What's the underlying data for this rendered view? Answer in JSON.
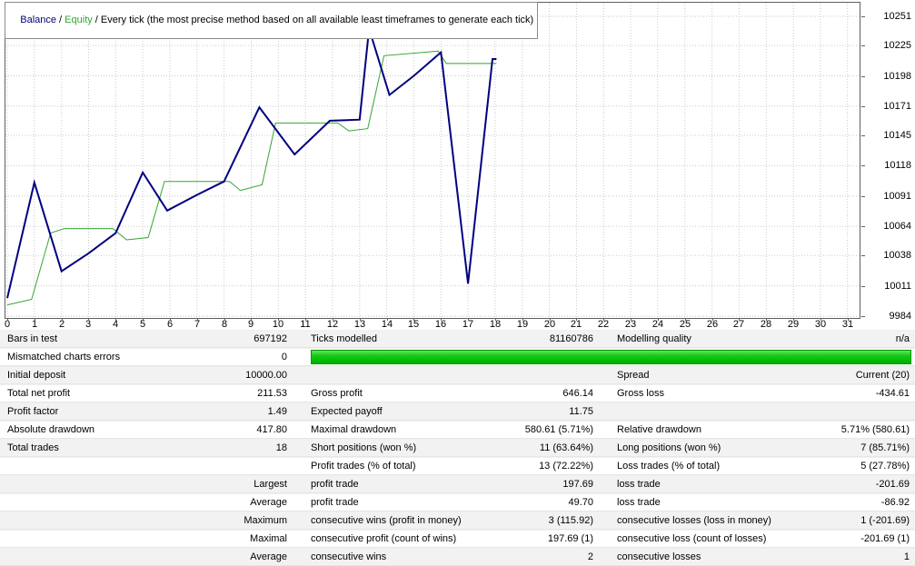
{
  "legend": {
    "balance_label": "Balance",
    "separator": " / ",
    "equity_label": "Equity",
    "method_label": " / Every tick (the most precise method based on all available least timeframes to generate each tick)"
  },
  "colors": {
    "balance_line": "#000080",
    "equity_line": "#32a532",
    "grid": "#c9c9c9",
    "quality_bar_green": "#12cb12",
    "row_alt_background": "#f2f2f2"
  },
  "chart_data": {
    "type": "line",
    "title": "",
    "xlabel": "",
    "ylabel": "",
    "grid": "dotted",
    "legend_position": "top-left",
    "xlim": [
      0,
      31.5
    ],
    "ylim": [
      9984,
      10251
    ],
    "x_ticks": [
      0,
      1,
      2,
      3,
      4,
      5,
      6,
      7,
      8,
      9,
      10,
      11,
      12,
      13,
      14,
      15,
      16,
      17,
      18,
      19,
      20,
      21,
      22,
      23,
      24,
      25,
      26,
      27,
      28,
      29,
      30,
      31
    ],
    "y_ticks": [
      10251,
      10225,
      10198,
      10171,
      10145,
      10118,
      10091,
      10064,
      10038,
      10011,
      9984
    ],
    "series": [
      {
        "name": "Balance",
        "color": "#000080",
        "width": 2,
        "points": [
          [
            0,
            10000
          ],
          [
            1,
            10103
          ],
          [
            2,
            10024
          ],
          [
            3,
            10040
          ],
          [
            4,
            10058
          ],
          [
            5,
            10112
          ],
          [
            5.9,
            10078
          ],
          [
            7,
            10092
          ],
          [
            8,
            10104
          ],
          [
            9.3,
            10170
          ],
          [
            10.6,
            10128
          ],
          [
            11.9,
            10158
          ],
          [
            13,
            10159
          ],
          [
            13.35,
            10240
          ],
          [
            14.1,
            10181
          ],
          [
            15,
            10198
          ],
          [
            16,
            10219
          ],
          [
            17,
            10013
          ],
          [
            17.9,
            10213
          ],
          [
            18.05,
            10213
          ]
        ]
      },
      {
        "name": "Equity",
        "color": "#32a532",
        "width": 1,
        "points": [
          [
            0,
            9994
          ],
          [
            0.9,
            9999
          ],
          [
            1.6,
            10058
          ],
          [
            2.1,
            10062
          ],
          [
            3.9,
            10062
          ],
          [
            4.4,
            10052
          ],
          [
            5.2,
            10054
          ],
          [
            5.8,
            10104
          ],
          [
            8.2,
            10104
          ],
          [
            8.6,
            10096
          ],
          [
            9.4,
            10101
          ],
          [
            9.9,
            10156
          ],
          [
            12.2,
            10156
          ],
          [
            12.6,
            10149
          ],
          [
            13.3,
            10151
          ],
          [
            13.9,
            10216
          ],
          [
            15.9,
            10220
          ],
          [
            16.2,
            10209
          ],
          [
            18.05,
            10209
          ]
        ]
      }
    ]
  },
  "report": {
    "rows": [
      {
        "cells": [
          "Bars in test",
          "697192",
          "Ticks modelled",
          "81160786",
          "Modelling quality",
          "n/a"
        ]
      },
      {
        "cells": [
          "Mismatched charts errors",
          "0",
          "",
          "",
          "",
          ""
        ],
        "quality_bar": true
      },
      {
        "cells": [
          "Initial deposit",
          "10000.00",
          "",
          "",
          "Spread",
          "Current (20)"
        ]
      },
      {
        "cells": [
          "Total net profit",
          "211.53",
          "Gross profit",
          "646.14",
          "Gross loss",
          "-434.61"
        ]
      },
      {
        "cells": [
          "Profit factor",
          "1.49",
          "Expected payoff",
          "11.75",
          "",
          ""
        ]
      },
      {
        "cells": [
          "Absolute drawdown",
          "417.80",
          "Maximal drawdown",
          "580.61 (5.71%)",
          "Relative drawdown",
          "5.71% (580.61)"
        ]
      },
      {
        "cells": [
          "Total trades",
          "18",
          "Short positions (won %)",
          "11 (63.64%)",
          "Long positions (won %)",
          "7 (85.71%)"
        ]
      },
      {
        "cells": [
          "",
          "",
          "Profit trades (% of total)",
          "13 (72.22%)",
          "Loss trades (% of total)",
          "5 (27.78%)"
        ]
      },
      {
        "cells": [
          "",
          "Largest",
          "profit trade",
          "197.69",
          "loss trade",
          "-201.69"
        ]
      },
      {
        "cells": [
          "",
          "Average",
          "profit trade",
          "49.70",
          "loss trade",
          "-86.92"
        ]
      },
      {
        "cells": [
          "",
          "Maximum",
          "consecutive wins (profit in money)",
          "3 (115.92)",
          "consecutive losses (loss in money)",
          "1 (-201.69)"
        ]
      },
      {
        "cells": [
          "",
          "Maximal",
          "consecutive profit (count of wins)",
          "197.69 (1)",
          "consecutive loss (count of losses)",
          "-201.69 (1)"
        ]
      },
      {
        "cells": [
          "",
          "Average",
          "consecutive wins",
          "2",
          "consecutive losses",
          "1"
        ]
      }
    ]
  }
}
